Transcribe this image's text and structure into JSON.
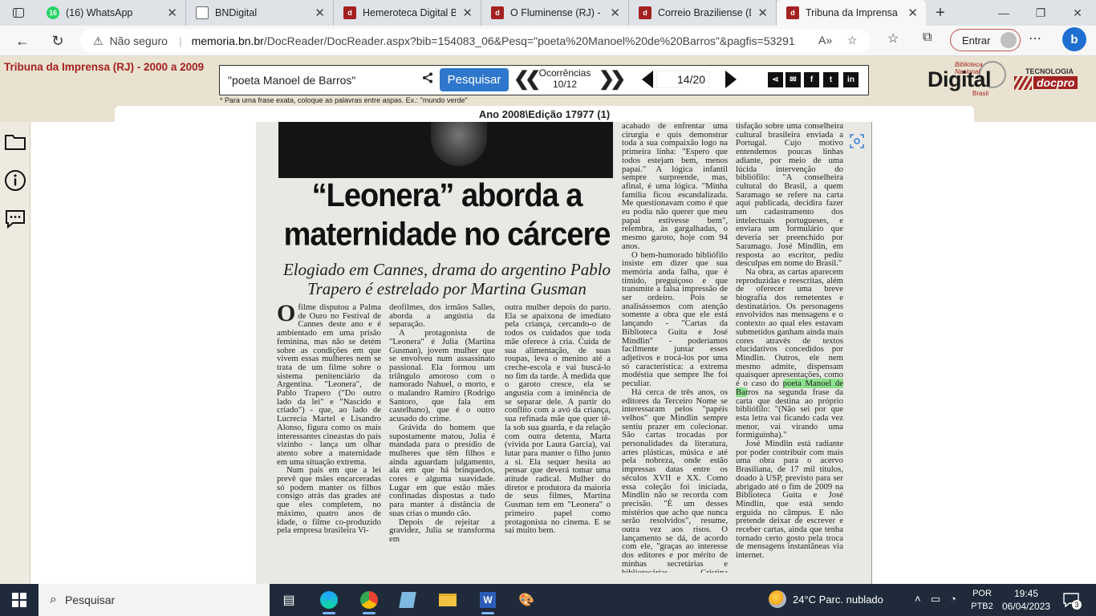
{
  "browser": {
    "tabs": [
      {
        "title": "(16) WhatsApp",
        "badge": "16",
        "color": "#25d366"
      },
      {
        "title": "BNDigital",
        "badge": "",
        "color": "#ffffff"
      },
      {
        "title": "Hemeroteca Digital Br",
        "badge": "",
        "color": "#a42121"
      },
      {
        "title": "O Fluminense (RJ) - 20",
        "badge": "",
        "color": "#a42121"
      },
      {
        "title": "Correio Braziliense (DF",
        "badge": "",
        "color": "#a42121"
      },
      {
        "title": "Tribuna da Imprensa (",
        "badge": "",
        "color": "#a42121"
      }
    ],
    "address": {
      "security_label": "Não seguro",
      "url_host": "memoria.bn.br",
      "url_path": "/DocReader/DocReader.aspx?bib=154083_06&Pesq=\"poeta%20Manoel%20de%20Barros\"&pagfis=53291"
    },
    "signin_label": "Entrar"
  },
  "site": {
    "title": "Tribuna da Imprensa (RJ) - 2000 a 2009",
    "search": {
      "query": "\"poeta Manoel de Barros\"",
      "button_label": "Pesquisar",
      "hint": "* Para uma frase exata, coloque as palavras entre aspas. Ex.: \"mundo verde\""
    },
    "occurrences": {
      "label": "Ocorrências",
      "value": "10/12"
    },
    "page": {
      "current": "14",
      "total": "/20"
    },
    "social": [
      "share",
      "email",
      "f",
      "twitter",
      "in"
    ],
    "logo": {
      "main": "Digital",
      "top": "Biblioteca Nacional",
      "bottom": "Brasil",
      "partner_top": "TECNOLOGIA",
      "partner": "docpro"
    },
    "edition": "Ano 2008\\Edição 17977 (1)"
  },
  "article": {
    "headline_line1": "“Leonera” aborda a",
    "headline_line2": "maternidade no cárcere",
    "subhead_line1": "Elogiado em Cannes, drama do argentino Pablo",
    "subhead_line2": "Trapero é estrelado por Martina Gusman",
    "col1_dropcap": "O",
    "col1_p1": "filme disputou a Palma de Ouro no Festival de Cannes deste ano e é ambientado em uma prisão feminina, mas não se detém sobre as condições em que vivem essas mulheres nem se trata de um filme sobre o sistema penitenciário da Argentina. \"Leonera\", de Pablo Trapero (\"Do outro lado da lei\" e \"Nascido e criado\") - que, ao lado de Lucrecia Martel e Lisandro Alonso, figura como os mais interessantes cineastas do país vizinho - lança um olhar atento sobre a maternidade em uma situação extrema.",
    "col1_p2": "Num país em que a lei prevê que mães encarceradas só podem manter os filhos consigo atrás das grades até que eles completem, no máximo, quatro anos de idade, o filme co-produzido pela empresa brasileira Vi-",
    "col2_p1": "deofilmes, dos irmãos Salles, aborda a angústia da separação.",
    "col2_p2": "A protagonista de \"Leonera\" é Julia (Martina Gusman), jovem mulher que se envolveu num assassinato passional. Ela formou um triângulo amoroso com o namorado Nahuel, o morto, e o malandro Ramiro (Rodrigo Santoro, que fala em castelhano), que é o outro acusado do crime.",
    "col2_p3": "Grávida do homem que supostamente matou, Julia é mandada para o presídio de mulheres que têm filhos e ainda aguardam julgamento, ala em que há brinquedos, cores e alguma suavidade. Lugar em que estão mães confinadas dispostas a tudo para manter à distância de suas crias o mundo cão.",
    "col2_p4": "Depois de rejeitar a gravidez, Julia se transforma em",
    "col3_p1": "outra mulher depois do parto. Ela se apaixona de imediato pela criança, cercando-o de todos os cuidados que toda mãe oferece à cria. Cuida de sua alimentação, de suas roupas, leva o menino até a creche-escola e vai buscá-lo no fim da tarde. À medida que o garoto cresce, ela se angustia com a iminência de se separar dele. A partir do conflito com a avó da criança, sua refinada mãe que quer tê-la sob sua guarda, e da relação com outra detenta, Marta (vivida por Laura Garcia), vai lutar para manter o filho junto a si. Ela sequer hesita ao pensar que deverá tomar uma atitude radical. Mulher do diretor e produtora da maioria de seus filmes, Martina Gusman tem em \"Leonera\" o primeiro papel como protagonista no cinema. E se sai muito bem.",
    "col4_p1": "acabado de enfrentar uma cirurgia e quis demonstrar toda a sua compaixão logo na primeira linha: \"Espero que todos estejam bem, menos papai.\" A lógica infantil sempre surpreende, mas, afinal, é uma lógica. \"Minha família ficou escandalizada. Me questionavam como é que eu podia não querer que meu papai estivesse bem\", relembra, às gargalhadas, o mesmo garoto, hoje com 94 anos.",
    "col4_p2": "O bem-humorado bibliófilo insiste em dizer que sua memória anda falha, que é tímido, preguiçoso e que transmite a falsa impressão de ser ordeiro. Pois se analisássemos com atenção somente a obra que ele está lançando - \"Cartas da Biblioteca Guita e José Mindlin\" - poderíamos facilmente juntar esses adjetivos e trocá-los por uma só característica: a extrema modéstia que sempre lhe foi peculiar.",
    "col4_p3": "Há cerca de três anos, os editores da Terceiro Nome se interessaram pelos \"papéis velhos\" que Mindlin sempre sentiu prazer em colecionar. São cartas trocadas por personalidades da literatura, artes plásticas, música e até pela nobreza, onde estão impressas datas entre os séculos XVII e XX. Como essa coleção foi iniciada, Mindlin não se recorda com precisão. \"É um desses mistérios que acho que nunca serão resolvidos\", resume, outra vez aos risos. O lançamento se dá, de acordo com ele, \"graças ao interesse dos editores e por mérito de minhas secretárias e bibliotecárias Cristina Antunes, Ro-",
    "col5_p1": "tisfação sobre uma conselheira cultural brasileira enviada a Portugal. Cujo motivo entendemos poucas linhas adiante, por meio de uma lúcida intervenção do bibliófilo: \"A conselheira cultural do Brasil, a quem Saramago se refere na carta aqui publicada, decidira fazer um cadastramento dos intelectuais portugueses, e enviara um formulário que deveria ser preenchido por Saramago. José Mindlin, em resposta ao escritor, pediu desculpas em nome do Brasil.\"",
    "col5_p2": "Na obra, as cartas aparecem reproduzidas e reescritas, além de oferecer uma breve biografia dos remetentes e destinatários. Os personagens envolvidos nas mensagens e o contexto ao qual eles estavam submetidos ganham ainda mais cores através de textos elucidativos concedidos por Mindlin. Outros, ele nem mesmo admite, dispensam quaisquer apresentações, como é o caso do ",
    "col5_highlight": "poeta Manoel de Bar",
    "col5_p2_end": "ros na segunda frase da carta que destina ao próprio bibliófilo: \"(Não sei por que esta letra vai ficando cada vez menor, vai virando uma formiguinha).\"",
    "col5_p3": "José Mindlin está radiante por poder contribuir com mais uma obra para o acervo Brasiliana, de 17 mil títulos, doado à USP, previsto para ser abrigado até o fim de 2009 na Biblioteca Guita e José Mindlin, que está sendo erguida no câmpus. E não pretende deixar de escrever e receber cartas, ainda que tenha tornado certo gosto pela troca de mensagens instantâneas via internet."
  },
  "taskbar": {
    "search_placeholder": "Pesquisar",
    "weather": "24°C  Parc. nublado",
    "lang_line1": "POR",
    "lang_line2": "PTB2",
    "time": "19:45",
    "date": "06/04/2023",
    "notifications": "3"
  }
}
